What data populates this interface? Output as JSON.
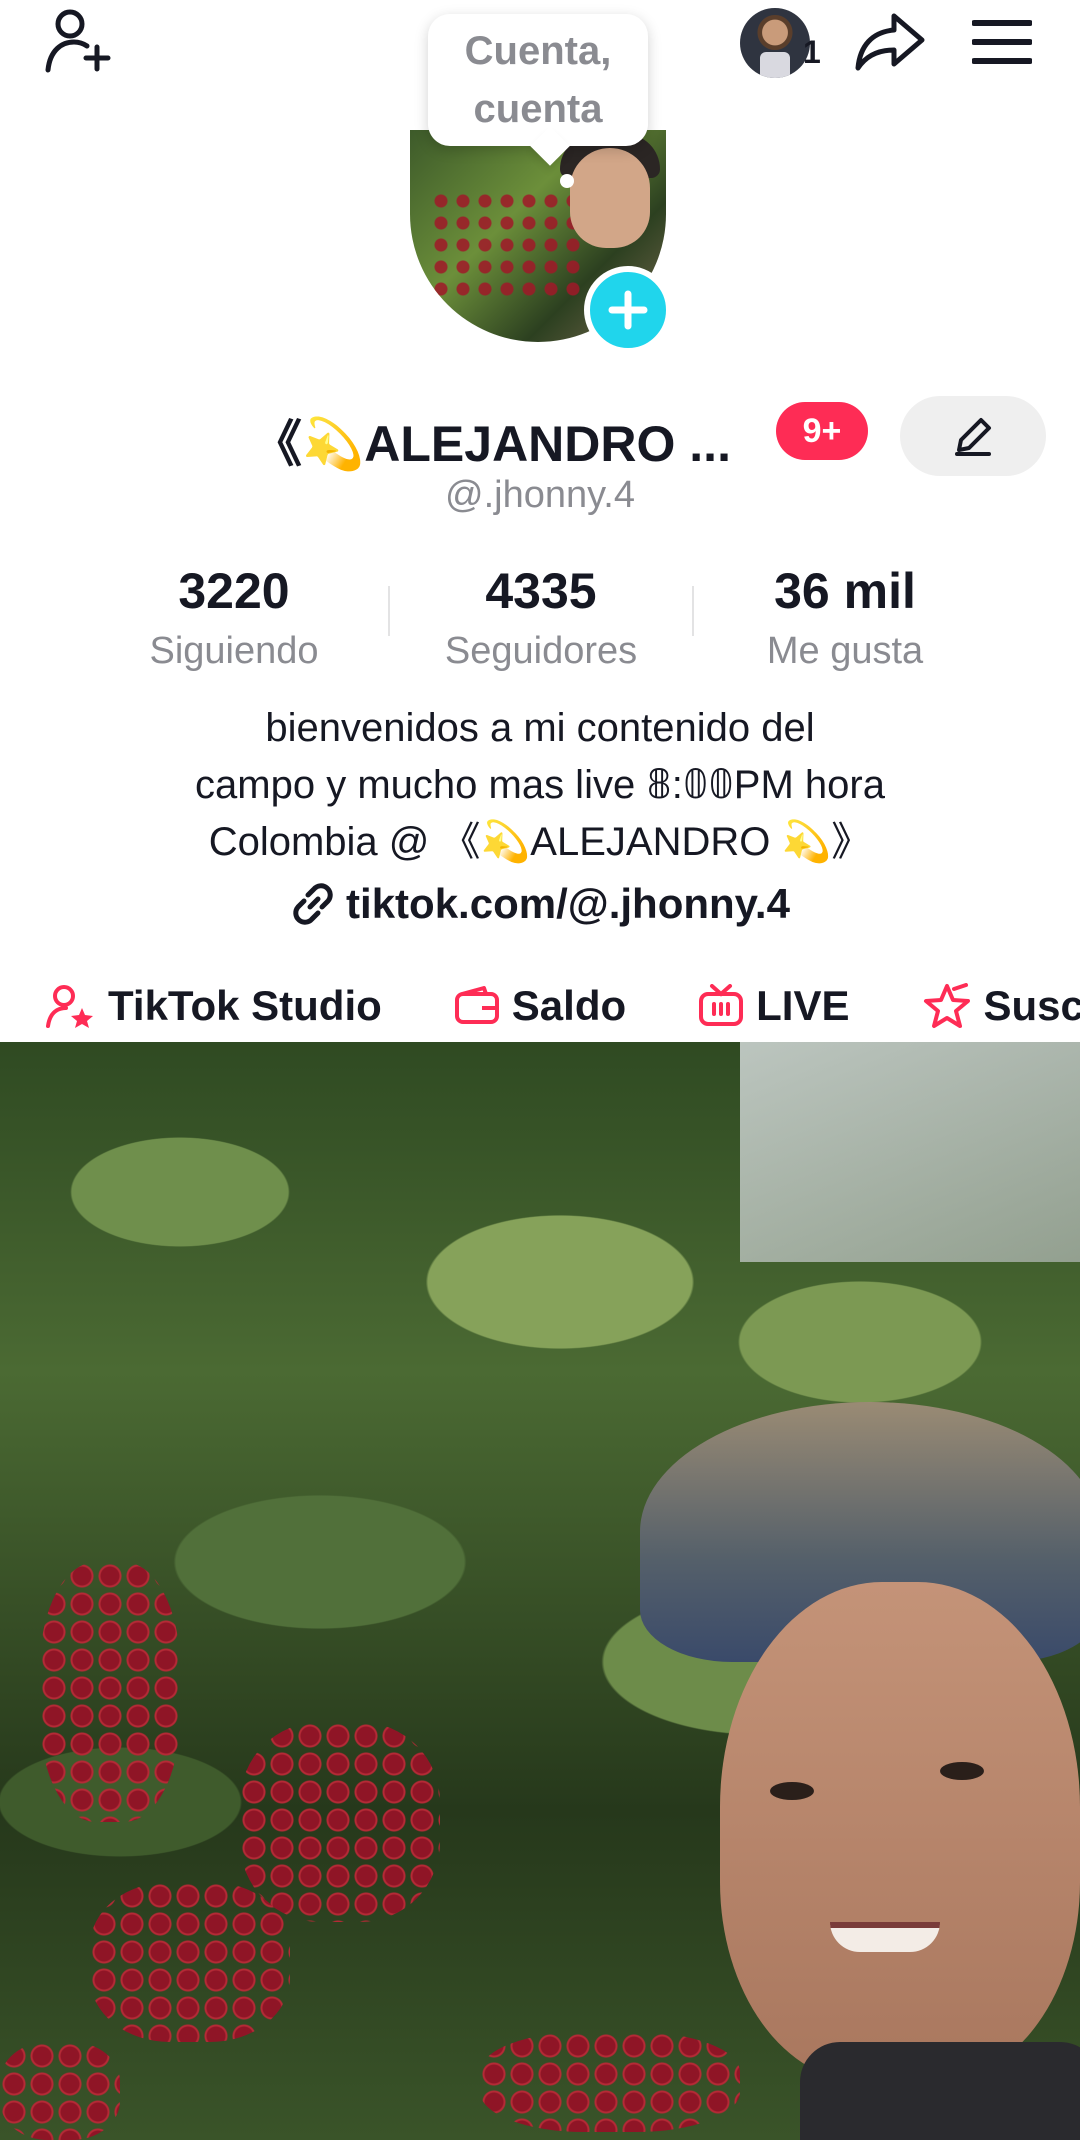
{
  "top": {
    "tooltip": "Cuenta, cuenta",
    "account_count": "1"
  },
  "profile": {
    "display_name": "《💫ALEJANDRO ...",
    "notifications_badge": "9+",
    "username": "@.jhonny.4"
  },
  "stats": [
    {
      "value": "3220",
      "label": "Siguiendo"
    },
    {
      "value": "4335",
      "label": "Seguidores"
    },
    {
      "value": "36 mil",
      "label": "Me gusta"
    }
  ],
  "bio": {
    "lines": [
      "bienvenidos  a mi contenido del",
      "campo y mucho mas live 𝟠:𝟘𝟘PM hora",
      "Colombia @ 《💫ALEJANDRO 💫》"
    ],
    "link": "tiktok.com/@.jhonny.4"
  },
  "tools": [
    {
      "label": "TikTok Studio",
      "icon": "creator-star-icon",
      "color": "#fe2c55"
    },
    {
      "label": "Saldo",
      "icon": "wallet-icon",
      "color": "#fe2c55"
    },
    {
      "label": "LIVE",
      "icon": "live-tv-icon",
      "color": "#fe2c55"
    },
    {
      "label": "Suscri",
      "icon": "subscription-star-icon",
      "color": "#fe2c55"
    }
  ],
  "colors": {
    "accent": "#fe2c55",
    "plus": "#20d5ec",
    "secondary_text": "#8a8b91"
  }
}
